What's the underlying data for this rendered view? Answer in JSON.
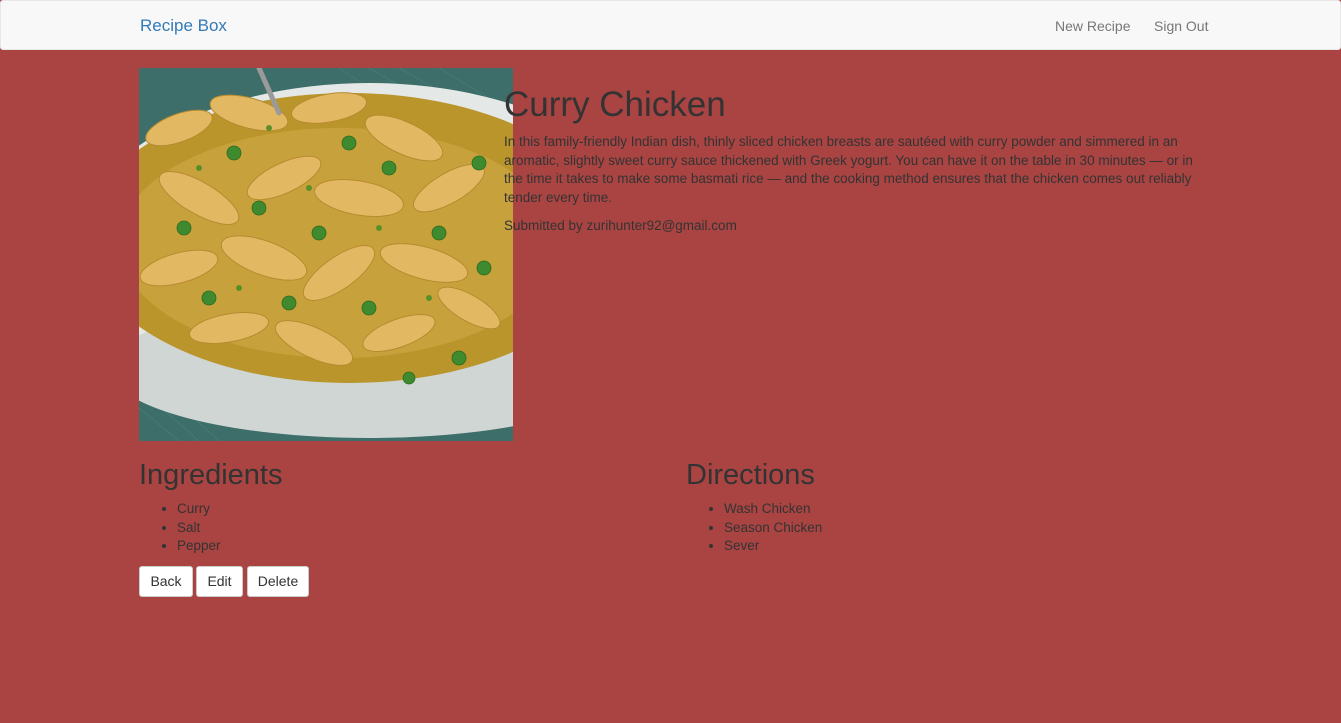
{
  "navbar": {
    "brand": "Recipe Box",
    "new_recipe": "New Recipe",
    "sign_out": "Sign Out"
  },
  "recipe": {
    "title": "Curry Chicken",
    "description": "In this family-friendly Indian dish, thinly sliced chicken breasts are sautéed with curry powder and simmered in an aromatic, slightly sweet curry sauce thickened with Greek yogurt. You can have it on the table in 30 minutes — or in the time it takes to make some basmati rice — and the cooking method ensures that the chicken comes out reliably tender every time.",
    "submitted_by": "Submitted by zurihunter92@gmail.com",
    "image_icon": "curry-chicken-photo"
  },
  "ingredients": {
    "heading": "Ingredients",
    "items": [
      "Curry",
      "Salt",
      "Pepper"
    ]
  },
  "directions": {
    "heading": "Directions",
    "items": [
      "Wash Chicken",
      "Season Chicken",
      "Sever"
    ]
  },
  "actions": {
    "back": "Back",
    "edit": "Edit",
    "delete": "Delete"
  },
  "colors": {
    "page_background": "#a94442",
    "navbar_background": "#f8f8f8",
    "brand": "#337ab7"
  }
}
